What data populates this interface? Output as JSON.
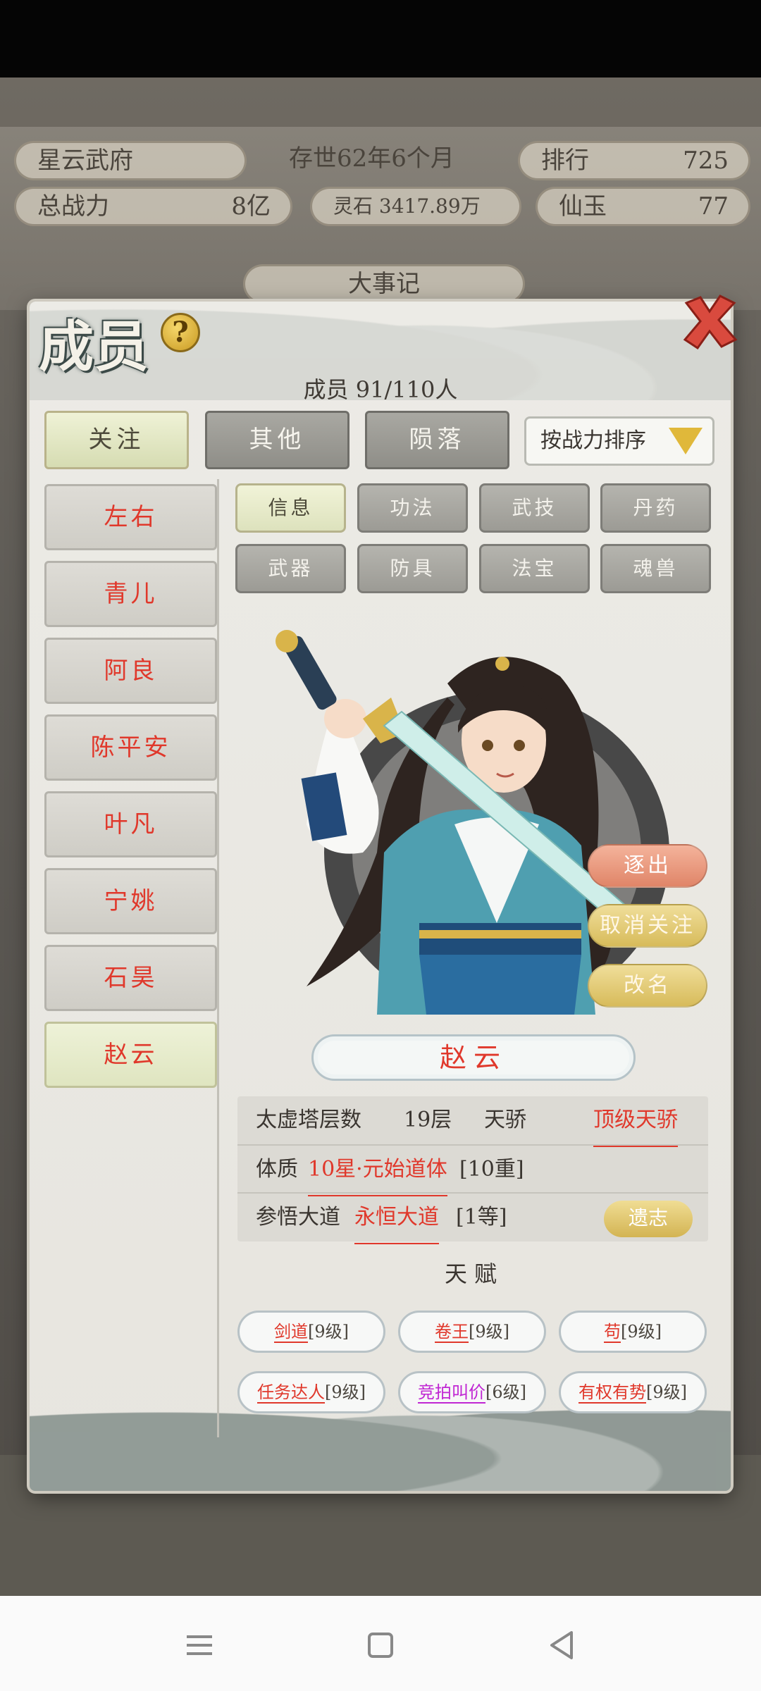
{
  "background": {
    "sect_name": "星云武府",
    "survival": "存世62年6个月",
    "rank_label": "排行",
    "rank_value": "725",
    "power_label": "总战力",
    "power_value": "8亿",
    "spirit_stone": "灵石 3417.89万",
    "immortal_jade_label": "仙玉",
    "immortal_jade_value": "77",
    "chronicle": "大事记"
  },
  "modal": {
    "title": "成员",
    "help_icon": "?",
    "member_count": "成员  91/110人",
    "tabs": [
      "关注",
      "其他",
      "陨落"
    ],
    "sort_label": "按战力排序",
    "members": [
      "左右",
      "青儿",
      "阿良",
      "陈平安",
      "叶凡",
      "宁姚",
      "石昊",
      "赵云"
    ],
    "subtabs_row1": [
      "信息",
      "功法",
      "武技",
      "丹药"
    ],
    "subtabs_row2": [
      "武器",
      "防具",
      "法宝",
      "魂兽"
    ],
    "actions": {
      "expel": "逐出",
      "unfollow": "取消关注",
      "rename": "改名"
    },
    "name": "赵云",
    "stats": {
      "tower_label": "太虚塔层数",
      "tower_value": "19层",
      "rank_label": "天骄",
      "rank_value": "顶级天骄",
      "physique_label": "体质",
      "physique_value": "10星·元始道体",
      "physique_level": "[10重]",
      "dao_label": "参悟大道",
      "dao_value": "永恒大道",
      "dao_level": "[1等]",
      "legacy_button": "遗志"
    },
    "talent_title": "天赋",
    "talents": [
      {
        "name": "剑道",
        "level": "[9级]"
      },
      {
        "name": "卷王",
        "level": "[9级]"
      },
      {
        "name": "苟",
        "level": "[9级]"
      },
      {
        "name": "任务达人",
        "level": "[9级]"
      },
      {
        "name": "竞拍叫价",
        "level": "[6级]"
      },
      {
        "name": "有权有势",
        "level": "[9级]"
      }
    ]
  },
  "colors": {
    "accent_red": "#e0382b",
    "gold": "#d7bb5a",
    "purple": "#c026d3"
  }
}
